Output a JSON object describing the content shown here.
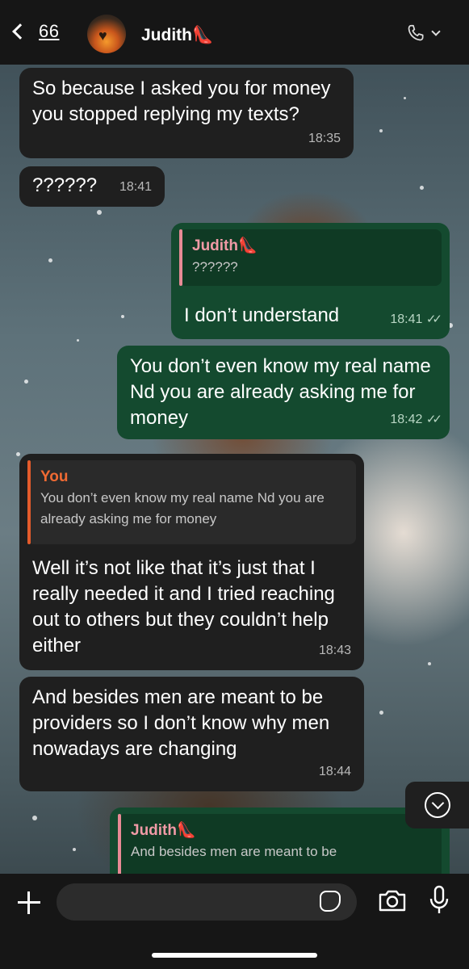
{
  "header": {
    "back_count": "66",
    "contact_name": "Judith",
    "contact_emoji": "👠"
  },
  "messages": [
    {
      "direction": "in",
      "text": "So because I asked you for money you stopped replying my texts?",
      "time": "18:35"
    },
    {
      "direction": "in",
      "text": "??????",
      "time": "18:41"
    },
    {
      "direction": "out",
      "quote_author": "Judith",
      "quote_emoji": "👠",
      "quote_text": "??????",
      "text": "I don’t understand",
      "time": "18:41",
      "status": "read"
    },
    {
      "direction": "out",
      "text": "You don’t even know my real name Nd you are already asking me for money",
      "time": "18:42",
      "status": "read"
    },
    {
      "direction": "in",
      "quote_author": "You",
      "quote_text": "You don’t even know my real name Nd you are already asking me for money",
      "text": "Well it’s not like that it’s just that I really needed it and I tried reaching out to others but they couldn’t help either",
      "time": "18:43"
    },
    {
      "direction": "in",
      "text": "And besides men are meant to be providers so I don’t know why men nowadays are changing",
      "time": "18:44"
    },
    {
      "direction": "out",
      "quote_author": "Judith",
      "quote_emoji": "👠",
      "quote_text": "And besides men are meant to be",
      "partial": true
    }
  ],
  "input": {
    "placeholder": "",
    "value": ""
  },
  "colors": {
    "incoming_bubble": "#1f1f1f",
    "outgoing_bubble": "#144a2f",
    "header_bg": "#161616",
    "quote_pink": "#f09aa6",
    "quote_orange": "#f06a33"
  },
  "icons": [
    "back-chevron-icon",
    "phone-icon",
    "chevron-down-icon",
    "scroll-down-icon",
    "plus-icon",
    "sticker-icon",
    "camera-icon",
    "microphone-icon",
    "double-check-icon"
  ]
}
